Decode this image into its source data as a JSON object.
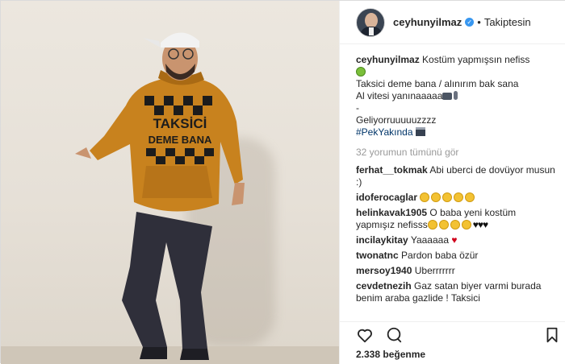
{
  "post": {
    "username": "ceyhunyilmaz",
    "follow_status": "Takiptesin",
    "separator": "•",
    "caption_lines": [
      "Kostüm yapmışsın nefiss",
      "Taksici deme bana / alınırım bak sana",
      "Al vitesi yanınaaaaa",
      "-",
      "Geliyorruuuuuzzzz"
    ],
    "hashtag": "#PekYakında",
    "view_all_comments": "32 yorumun tümünü gör",
    "comments": [
      {
        "user": "ferhat__tokmak",
        "text": "Abi uberci de dovüyor musun :)"
      },
      {
        "user": "idoferocaglar",
        "text": ""
      },
      {
        "user": "helinkavak1905",
        "text": "O baba yeni kostüm yapmışız nefisss"
      },
      {
        "user": "incilaykitay",
        "text": "Yaaaaaa"
      },
      {
        "user": "twonatnc",
        "text": "Pardon baba özür"
      },
      {
        "user": "mersoy1940",
        "text": "Uberrrrrrr"
      },
      {
        "user": "cevdetnezih",
        "text": "Gaz satan biyer varmi burada benim araba gazlide ! Taksici"
      }
    ],
    "likes": "2.338 beğenme",
    "hoodie_text_1": "TAKSİCİ",
    "hoodie_text_2": "DEME BANA",
    "icons": {
      "like": "heart-outline-icon",
      "comment": "speech-bubble-icon",
      "save": "bookmark-icon",
      "verified": "verified-badge-icon"
    },
    "colors": {
      "link": "#003569",
      "verified": "#3897f0",
      "muted": "#999999",
      "hoodie": "#c8821e"
    }
  }
}
